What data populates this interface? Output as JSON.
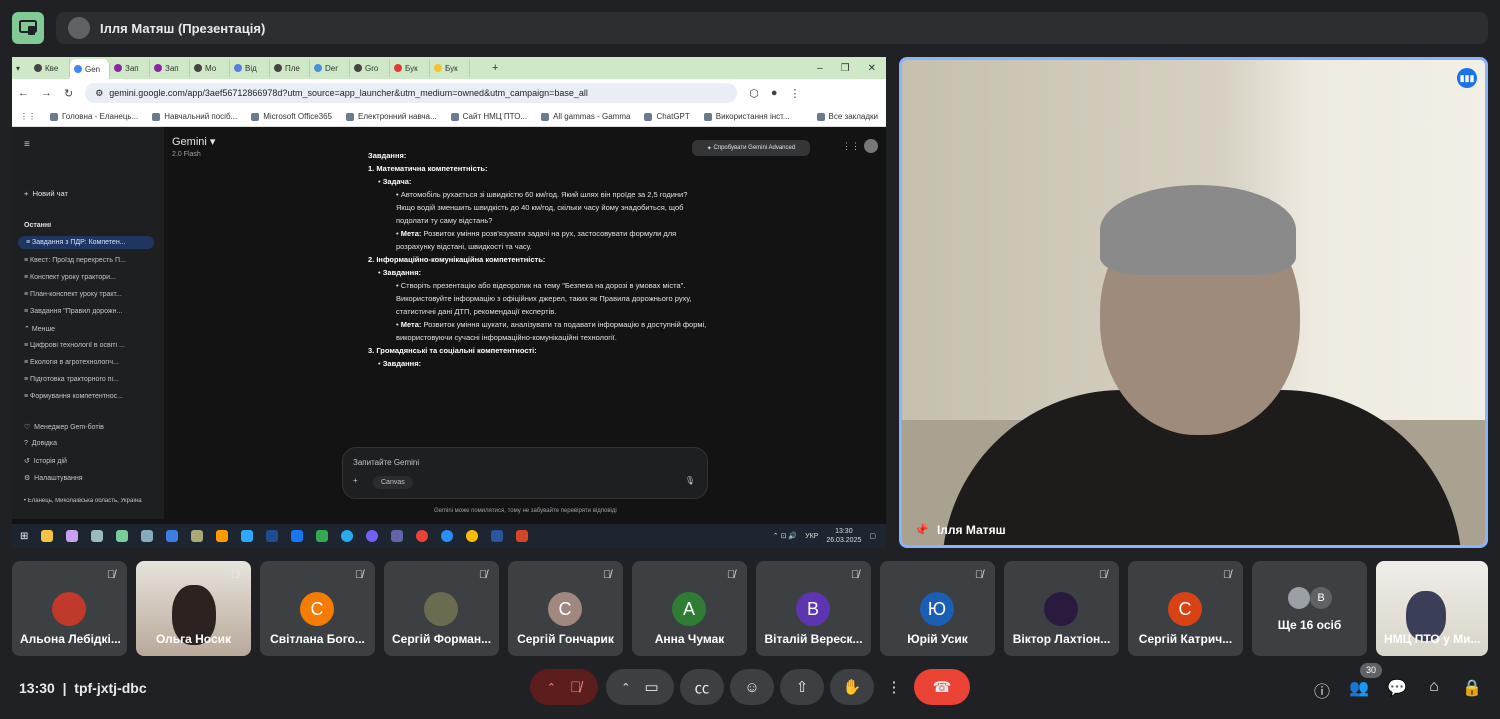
{
  "header": {
    "presenter_title": "Ілля Матяш (Презентація)"
  },
  "browser": {
    "tabs": [
      "Кве",
      "Gen",
      "Зап",
      "Зап",
      "Мо",
      "Від",
      "Пле",
      "Der",
      "Gro",
      "Бук",
      "Бук"
    ],
    "url": "gemini.google.com/app/3aef56712866978d?utm_source=app_launcher&utm_medium=owned&utm_campaign=base_all",
    "bookmarks": [
      "Головна - Еланець...",
      "Навчальний посіб...",
      "Microsoft Office365",
      "Електронний навча...",
      "Сайт НМЦ ПТО...",
      "All gammas - Gamma",
      "ChatGPT",
      "Використання інст..."
    ],
    "bookmarks_all": "Все закладки"
  },
  "gemini": {
    "title": "Gemini",
    "model": "2.0 Flash",
    "advanced_btn": "Спробувати Gemini Advanced",
    "new_chat": "Новий чат",
    "recent_label": "Останні",
    "recent": [
      "Завдання з ПДР: Компетен...",
      "Квест: Проїзд перехресть П...",
      "Конспект уроку трактори...",
      "План-конспект уроку тракт...",
      "Завдання \"Правил дорожн...",
      "Менше",
      "Цифрові технології в освіті ...",
      "Екологія в агротехнологіч...",
      "Підготовка тракторного пі...",
      "Формування компетентнос..."
    ],
    "footer_items": [
      "Менеджер Gem-ботів",
      "Довідка",
      "Історія дій",
      "Налаштування"
    ],
    "location": "Еланець, Миколаївська область, Україна",
    "heading": "Завдання:",
    "s1": "1. Математична компетентність:",
    "s1_task": "Задача:",
    "s1_text": "Автомобіль рухається зі швидкістю 60 км/год. Який шлях він проїде за 2,5 години? Якщо водій зменшить швидкість до 40 км/год, скільки часу йому знадобиться, щоб подолати ту саму відстань?",
    "goal": "Мета:",
    "s1_goal": "Розвиток уміння розв'язувати задачі на рух, застосовувати формули для розрахунку відстані, швидкості та часу.",
    "s2": "2. Інформаційно-комунікаційна компетентність:",
    "s2_task": "Завдання:",
    "s2_text": "Створіть презентацію або відеоролик на тему \"Безпека на дорозі в умовах міста\". Використовуйте інформацію з офіційних джерел, таких як Правила дорожнього руху, статистичні дані ДТП, рекомендації експертів.",
    "s2_goal": "Розвиток уміння шукати, аналізувати та подавати інформацію в доступній формі, використовуючи сучасні інформаційно-комунікаційні технології.",
    "s3": "3. Громадянські та соціальні компетентності:",
    "s3_task": "Завдання:",
    "prompt_placeholder": "Запитайте Gemini",
    "canvas": "Canvas",
    "disclaimer": "Gemini може помилятися, тому не забувайте перевіряти відповіді"
  },
  "taskbar": {
    "lang": "УКР",
    "time": "13:30",
    "date": "26.03.2025"
  },
  "speaker": {
    "name": "Ілля Матяш"
  },
  "participants": [
    {
      "name": "Альона Лебідкі...",
      "initial": "",
      "color": "#c0392b"
    },
    {
      "name": "Ольга Носик",
      "initial": "",
      "color": ""
    },
    {
      "name": "Світлана Бого...",
      "initial": "С",
      "color": "#f57c00"
    },
    {
      "name": "Сергій Форман...",
      "initial": "",
      "color": "#6b6b4f"
    },
    {
      "name": "Сергій Гончарик",
      "initial": "С",
      "color": "#a1887f"
    },
    {
      "name": "Анна Чумак",
      "initial": "А",
      "color": "#2e7d32"
    },
    {
      "name": "Віталій Вереск...",
      "initial": "В",
      "color": "#5e35b1"
    },
    {
      "name": "Юрій Усик",
      "initial": "Ю",
      "color": "#1a5fb4"
    },
    {
      "name": "Віктор Лахтіон...",
      "initial": "",
      "color": "#2a1a3e"
    },
    {
      "name": "Сергій Катрич...",
      "initial": "С",
      "color": "#d84315"
    },
    {
      "name": "Ще 16 осіб",
      "initial": "В",
      "color": "#5f6368"
    },
    {
      "name": "НМЦ ПТО у Ми...",
      "initial": "",
      "color": ""
    }
  ],
  "footer": {
    "time": "13:30",
    "meeting_code": "tpf-jxtj-dbc",
    "people_count": "30"
  }
}
